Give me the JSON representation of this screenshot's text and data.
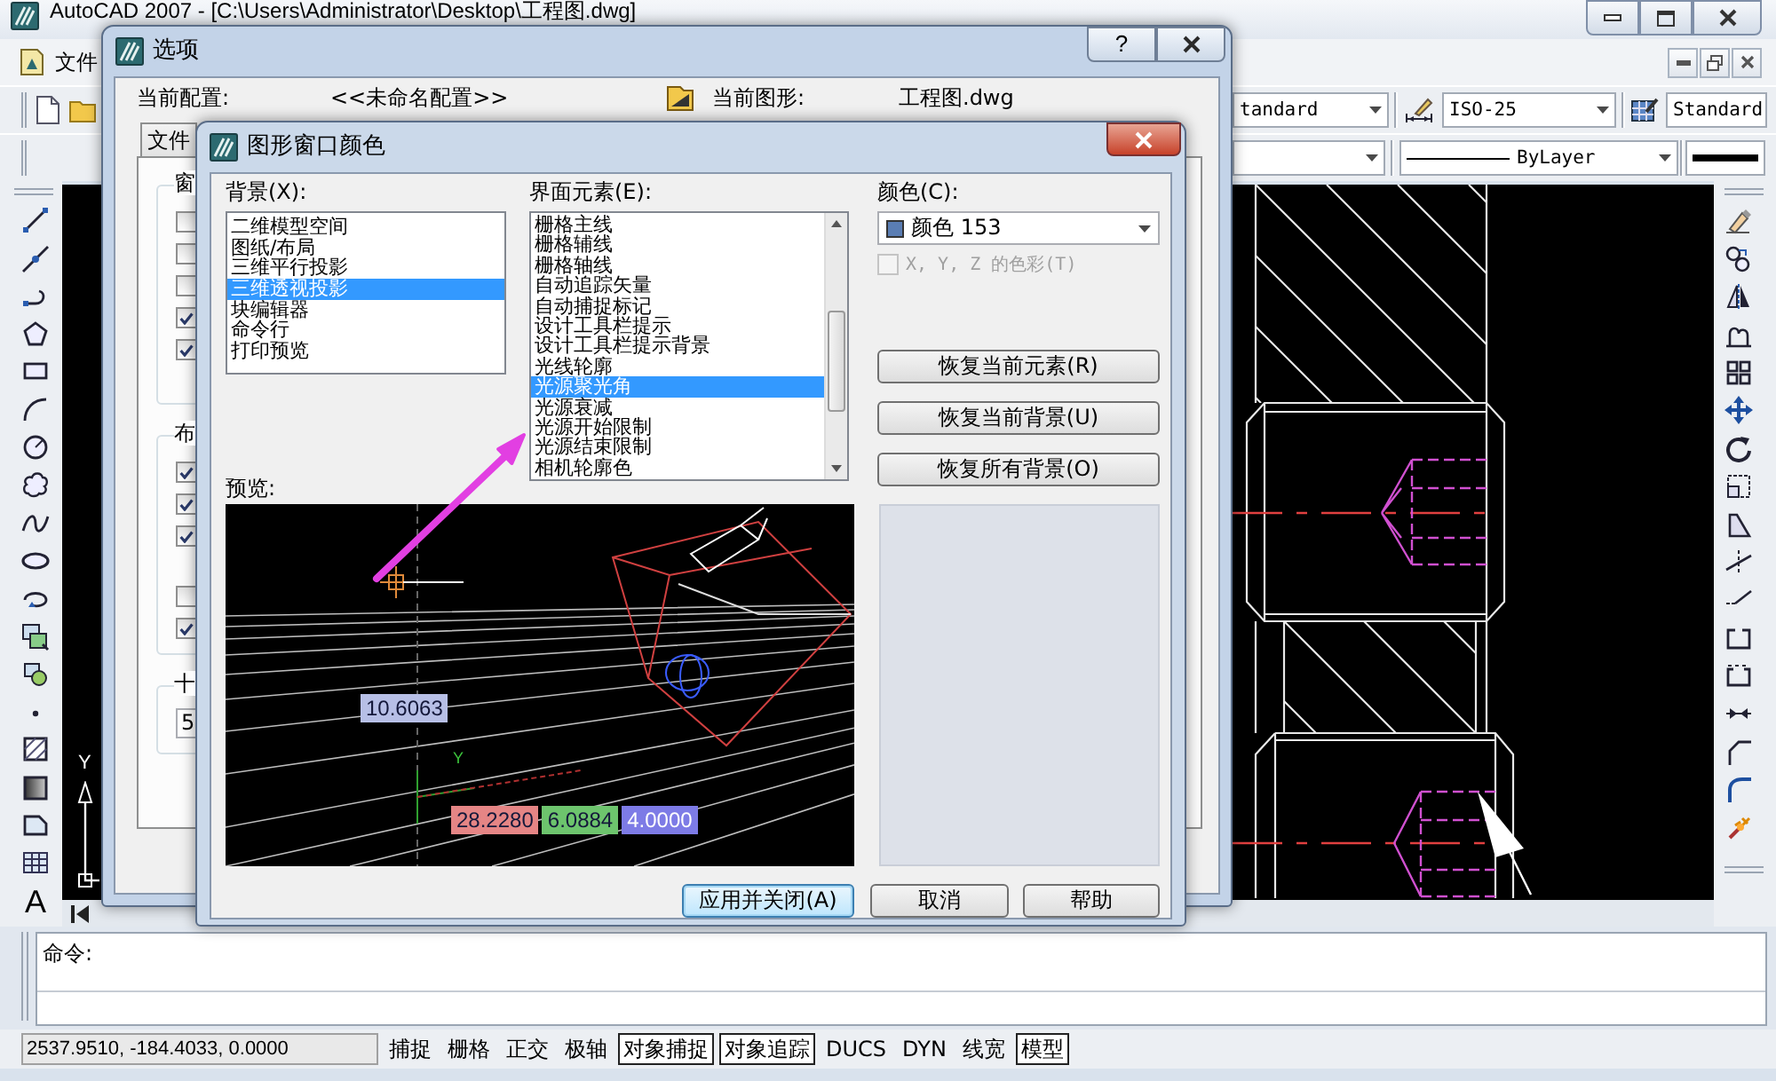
{
  "app_window": {
    "title": "AutoCAD 2007 - [C:\\Users\\Administrator\\Desktop\\工程图.dwg]"
  },
  "menu_bar": {
    "items": [
      "文件"
    ]
  },
  "styles_toolbar": {
    "text_style": "tandard",
    "dimension_style": "ISO-25",
    "table_style": "Standard"
  },
  "properties_toolbar": {
    "linetype": "ByLayer"
  },
  "draw_toolbar": {
    "text_tool": "A"
  },
  "drawing_area": {
    "ucs_axis_label": "Y"
  },
  "command_line": {
    "prompt": "命令:"
  },
  "status_bar": {
    "coordinates": "2537.9510, -184.4033, 0.0000",
    "toggles": [
      {
        "label": "捕捉",
        "on": false
      },
      {
        "label": "栅格",
        "on": false
      },
      {
        "label": "正交",
        "on": false
      },
      {
        "label": "极轴",
        "on": false
      },
      {
        "label": "对象捕捉",
        "on": true
      },
      {
        "label": "对象追踪",
        "on": true
      },
      {
        "label": "DUCS",
        "on": false
      },
      {
        "label": "DYN",
        "on": false
      },
      {
        "label": "线宽",
        "on": false
      },
      {
        "label": "模型",
        "on": true
      }
    ]
  },
  "options_dialog": {
    "title": "选项",
    "help_button": "?",
    "current_profile_label": "当前配置:",
    "current_profile": "<<未命名配置>>",
    "current_drawing_label": "当前图形:",
    "current_drawing": "工程图.dwg",
    "tabs": [
      {
        "label": "文件",
        "selected": false
      }
    ],
    "groups": [
      {
        "kind": "checkboxes",
        "label": "窗",
        "blocks": [
          [
            {
              "checked": false
            },
            {
              "checked": false
            },
            {
              "checked": false
            },
            {
              "checked": true
            },
            {
              "checked": true
            }
          ]
        ]
      },
      {
        "kind": "checkboxes",
        "label": "布",
        "blocks": [
          [
            {
              "checked": true
            },
            {
              "checked": true
            },
            {
              "checked": true
            }
          ],
          [
            {
              "checked": false
            },
            {
              "checked": true
            }
          ]
        ]
      },
      {
        "kind": "field",
        "label": "十",
        "value": "5"
      }
    ]
  },
  "color_dialog": {
    "title": "图形窗口颜色",
    "context_label": "背景(X):",
    "contexts": [
      {
        "label": "二维模型空间",
        "selected": false
      },
      {
        "label": "图纸/布局",
        "selected": false
      },
      {
        "label": "三维平行投影",
        "selected": false
      },
      {
        "label": "三维透视投影",
        "selected": true
      },
      {
        "label": "块编辑器",
        "selected": false
      },
      {
        "label": "命令行",
        "selected": false
      },
      {
        "label": "打印预览",
        "selected": false
      }
    ],
    "elements_label": "界面元素(E):",
    "elements": [
      {
        "label": "栅格主线",
        "selected": false
      },
      {
        "label": "栅格辅线",
        "selected": false
      },
      {
        "label": "栅格轴线",
        "selected": false
      },
      {
        "label": "自动追踪矢量",
        "selected": false
      },
      {
        "label": "自动捕捉标记",
        "selected": false
      },
      {
        "label": "设计工具栏提示",
        "selected": false
      },
      {
        "label": "设计工具栏提示背景",
        "selected": false
      },
      {
        "label": "光线轮廓",
        "selected": false
      },
      {
        "label": "光源聚光角",
        "selected": true
      },
      {
        "label": "光源衰减",
        "selected": false
      },
      {
        "label": "光源开始限制",
        "selected": false
      },
      {
        "label": "光源结束限制",
        "selected": false
      },
      {
        "label": "相机轮廓色",
        "selected": false
      }
    ],
    "color_label": "颜色(C):",
    "color_value": "颜色 153",
    "color": "#5a7db3",
    "tint_checkbox": {
      "label": "X, Y, Z 的色彩(T)",
      "checked": false,
      "disabled": true
    },
    "restore_buttons": [
      {
        "label": "恢复当前元素(R)"
      },
      {
        "label": "恢复当前背景(U)"
      },
      {
        "label": "恢复所有背景(O)"
      }
    ],
    "preview_label": "预览:",
    "preview": {
      "axis_label": "Y",
      "distance_readout": {
        "text": "10.6063",
        "color": "#b7bfe6"
      },
      "coordinate_readouts": [
        {
          "text": "28.2280",
          "color": "#e58585"
        },
        {
          "text": "6.0884",
          "color": "#6dc46d"
        },
        {
          "text": "4.0000",
          "color": "#7d7be6"
        }
      ]
    },
    "buttons": [
      {
        "label": "应用并关闭(A)",
        "default": true
      },
      {
        "label": "取消",
        "default": false
      },
      {
        "label": "帮助",
        "default": false
      }
    ]
  }
}
